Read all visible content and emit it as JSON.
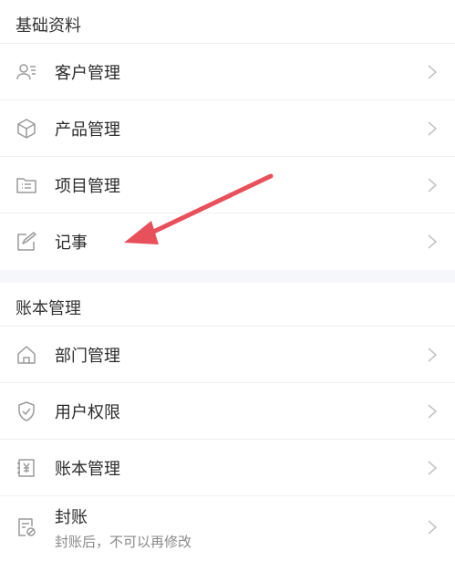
{
  "sections": [
    {
      "title": "基础资料",
      "items": [
        {
          "label": "客户管理",
          "icon": "customer-icon"
        },
        {
          "label": "产品管理",
          "icon": "cube-icon"
        },
        {
          "label": "项目管理",
          "icon": "folder-list-icon"
        },
        {
          "label": "记事",
          "icon": "note-edit-icon"
        }
      ]
    },
    {
      "title": "账本管理",
      "items": [
        {
          "label": "部门管理",
          "icon": "home-icon"
        },
        {
          "label": "用户权限",
          "icon": "shield-check-icon"
        },
        {
          "label": "账本管理",
          "icon": "ledger-yen-icon"
        },
        {
          "label": "封账",
          "sub": "封账后，不可以再修改",
          "icon": "lock-document-icon"
        }
      ]
    }
  ],
  "colors": {
    "accent_arrow": "#e8505b",
    "icon_gray": "#9a9a9a",
    "divider": "#efeff1",
    "section_gap": "#f6f7fb"
  }
}
